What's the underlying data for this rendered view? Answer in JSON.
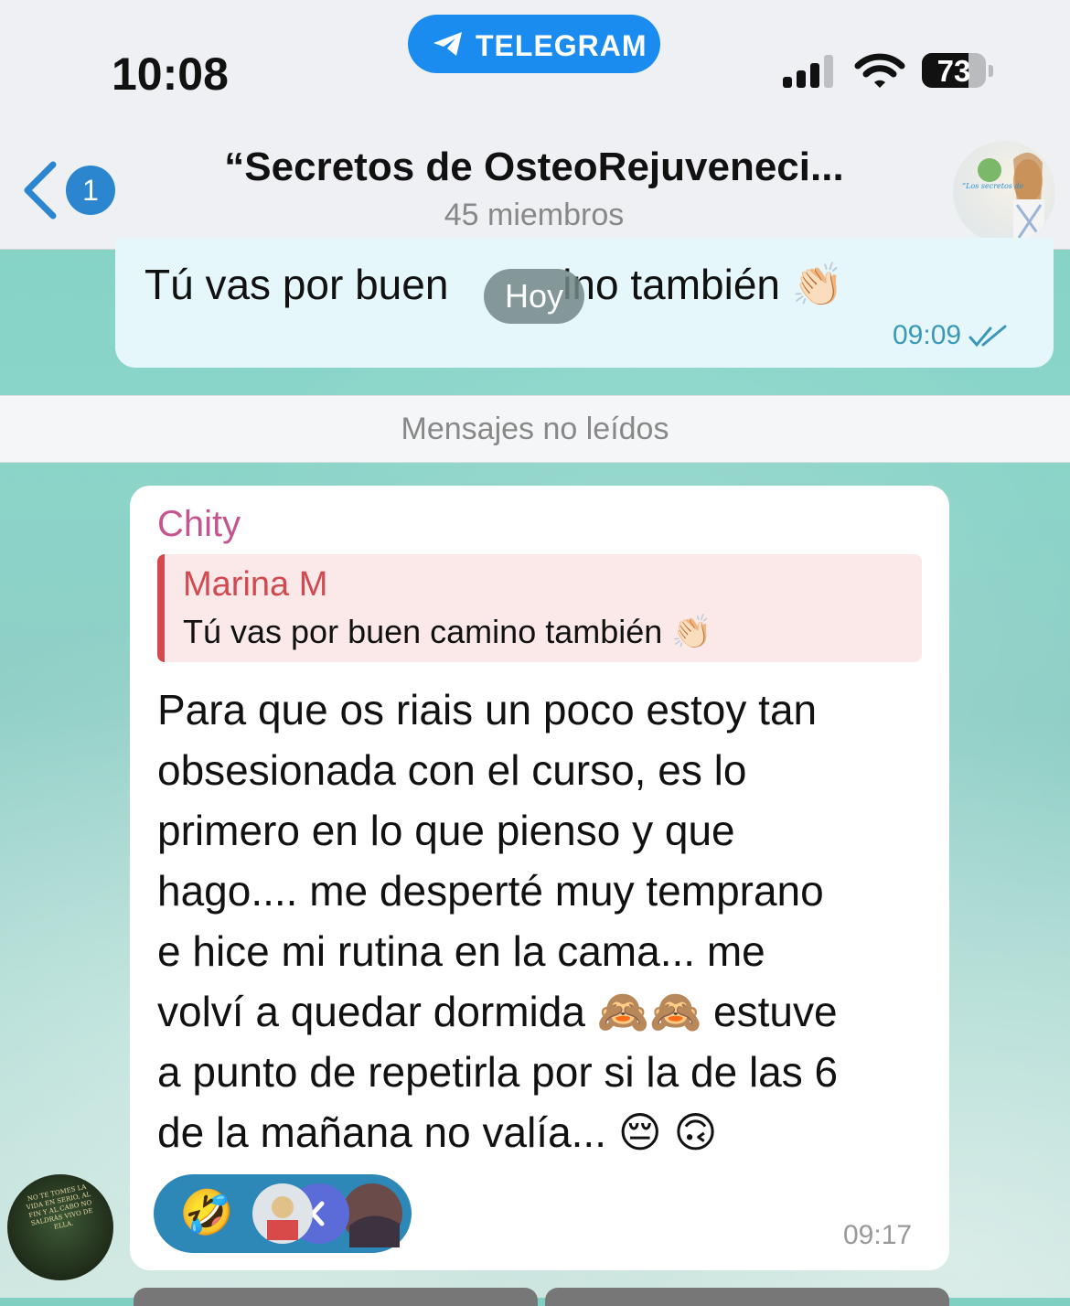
{
  "status_bar": {
    "time": "10:08",
    "app_pill": "TELEGRAM",
    "battery": "73",
    "battery_level": 0.73
  },
  "header": {
    "back_count": "1",
    "title": "“Secretos de OsteoRejuveneci...",
    "subtitle": "45 miembros",
    "avatar_text": "“Los secretos de"
  },
  "previous_message": {
    "text_before": "Tú vas por buen ",
    "text_after": "ino también 👏🏻",
    "time": "09:09",
    "status_icon": "double-check-icon"
  },
  "date_pill": "Hoy",
  "unread_divider": "Mensajes no leídos",
  "message": {
    "sender": "Chity",
    "reply": {
      "name": "Marina M",
      "text": "Tú vas por buen camino también 👏🏻"
    },
    "lines": [
      "Para que os riais un poco estoy tan",
      "obsesionada con el curso, es lo",
      "primero en lo que pienso y que",
      "hago.... me desperté muy temprano",
      "e hice mi rutina en la cama... me",
      "volví a quedar dormida 🙈🙈 estuve",
      "a punto de repetirla por si la de las 6",
      "de la mañana no valía... 😔 🙃"
    ],
    "reaction_emoji": "🤣",
    "time": "09:17"
  },
  "sender_avatar_text": "NO TE TOMES LA VIDA EN SERIO, AL FIN Y AL CABO NO SALDRÁS VIVO DE ELLA.",
  "colors": {
    "accent": "#1a8cf0",
    "badge": "#2b86cf",
    "sender_name": "#c5558e",
    "reply_accent": "#d5484f",
    "outgoing_bubble": "#e6f7fb",
    "reaction_bg": "#2d88b7"
  }
}
